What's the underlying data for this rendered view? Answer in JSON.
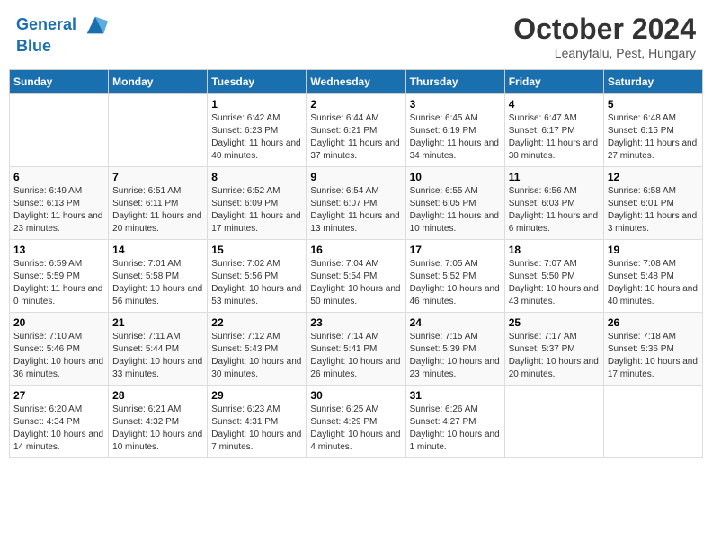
{
  "header": {
    "logo_line1": "General",
    "logo_line2": "Blue",
    "month_title": "October 2024",
    "location": "Leanyfalu, Pest, Hungary"
  },
  "weekdays": [
    "Sunday",
    "Monday",
    "Tuesday",
    "Wednesday",
    "Thursday",
    "Friday",
    "Saturday"
  ],
  "weeks": [
    [
      {
        "day": "",
        "sunrise": "",
        "sunset": "",
        "daylight": ""
      },
      {
        "day": "",
        "sunrise": "",
        "sunset": "",
        "daylight": ""
      },
      {
        "day": "1",
        "sunrise": "Sunrise: 6:42 AM",
        "sunset": "Sunset: 6:23 PM",
        "daylight": "Daylight: 11 hours and 40 minutes."
      },
      {
        "day": "2",
        "sunrise": "Sunrise: 6:44 AM",
        "sunset": "Sunset: 6:21 PM",
        "daylight": "Daylight: 11 hours and 37 minutes."
      },
      {
        "day": "3",
        "sunrise": "Sunrise: 6:45 AM",
        "sunset": "Sunset: 6:19 PM",
        "daylight": "Daylight: 11 hours and 34 minutes."
      },
      {
        "day": "4",
        "sunrise": "Sunrise: 6:47 AM",
        "sunset": "Sunset: 6:17 PM",
        "daylight": "Daylight: 11 hours and 30 minutes."
      },
      {
        "day": "5",
        "sunrise": "Sunrise: 6:48 AM",
        "sunset": "Sunset: 6:15 PM",
        "daylight": "Daylight: 11 hours and 27 minutes."
      }
    ],
    [
      {
        "day": "6",
        "sunrise": "Sunrise: 6:49 AM",
        "sunset": "Sunset: 6:13 PM",
        "daylight": "Daylight: 11 hours and 23 minutes."
      },
      {
        "day": "7",
        "sunrise": "Sunrise: 6:51 AM",
        "sunset": "Sunset: 6:11 PM",
        "daylight": "Daylight: 11 hours and 20 minutes."
      },
      {
        "day": "8",
        "sunrise": "Sunrise: 6:52 AM",
        "sunset": "Sunset: 6:09 PM",
        "daylight": "Daylight: 11 hours and 17 minutes."
      },
      {
        "day": "9",
        "sunrise": "Sunrise: 6:54 AM",
        "sunset": "Sunset: 6:07 PM",
        "daylight": "Daylight: 11 hours and 13 minutes."
      },
      {
        "day": "10",
        "sunrise": "Sunrise: 6:55 AM",
        "sunset": "Sunset: 6:05 PM",
        "daylight": "Daylight: 11 hours and 10 minutes."
      },
      {
        "day": "11",
        "sunrise": "Sunrise: 6:56 AM",
        "sunset": "Sunset: 6:03 PM",
        "daylight": "Daylight: 11 hours and 6 minutes."
      },
      {
        "day": "12",
        "sunrise": "Sunrise: 6:58 AM",
        "sunset": "Sunset: 6:01 PM",
        "daylight": "Daylight: 11 hours and 3 minutes."
      }
    ],
    [
      {
        "day": "13",
        "sunrise": "Sunrise: 6:59 AM",
        "sunset": "Sunset: 5:59 PM",
        "daylight": "Daylight: 11 hours and 0 minutes."
      },
      {
        "day": "14",
        "sunrise": "Sunrise: 7:01 AM",
        "sunset": "Sunset: 5:58 PM",
        "daylight": "Daylight: 10 hours and 56 minutes."
      },
      {
        "day": "15",
        "sunrise": "Sunrise: 7:02 AM",
        "sunset": "Sunset: 5:56 PM",
        "daylight": "Daylight: 10 hours and 53 minutes."
      },
      {
        "day": "16",
        "sunrise": "Sunrise: 7:04 AM",
        "sunset": "Sunset: 5:54 PM",
        "daylight": "Daylight: 10 hours and 50 minutes."
      },
      {
        "day": "17",
        "sunrise": "Sunrise: 7:05 AM",
        "sunset": "Sunset: 5:52 PM",
        "daylight": "Daylight: 10 hours and 46 minutes."
      },
      {
        "day": "18",
        "sunrise": "Sunrise: 7:07 AM",
        "sunset": "Sunset: 5:50 PM",
        "daylight": "Daylight: 10 hours and 43 minutes."
      },
      {
        "day": "19",
        "sunrise": "Sunrise: 7:08 AM",
        "sunset": "Sunset: 5:48 PM",
        "daylight": "Daylight: 10 hours and 40 minutes."
      }
    ],
    [
      {
        "day": "20",
        "sunrise": "Sunrise: 7:10 AM",
        "sunset": "Sunset: 5:46 PM",
        "daylight": "Daylight: 10 hours and 36 minutes."
      },
      {
        "day": "21",
        "sunrise": "Sunrise: 7:11 AM",
        "sunset": "Sunset: 5:44 PM",
        "daylight": "Daylight: 10 hours and 33 minutes."
      },
      {
        "day": "22",
        "sunrise": "Sunrise: 7:12 AM",
        "sunset": "Sunset: 5:43 PM",
        "daylight": "Daylight: 10 hours and 30 minutes."
      },
      {
        "day": "23",
        "sunrise": "Sunrise: 7:14 AM",
        "sunset": "Sunset: 5:41 PM",
        "daylight": "Daylight: 10 hours and 26 minutes."
      },
      {
        "day": "24",
        "sunrise": "Sunrise: 7:15 AM",
        "sunset": "Sunset: 5:39 PM",
        "daylight": "Daylight: 10 hours and 23 minutes."
      },
      {
        "day": "25",
        "sunrise": "Sunrise: 7:17 AM",
        "sunset": "Sunset: 5:37 PM",
        "daylight": "Daylight: 10 hours and 20 minutes."
      },
      {
        "day": "26",
        "sunrise": "Sunrise: 7:18 AM",
        "sunset": "Sunset: 5:36 PM",
        "daylight": "Daylight: 10 hours and 17 minutes."
      }
    ],
    [
      {
        "day": "27",
        "sunrise": "Sunrise: 6:20 AM",
        "sunset": "Sunset: 4:34 PM",
        "daylight": "Daylight: 10 hours and 14 minutes."
      },
      {
        "day": "28",
        "sunrise": "Sunrise: 6:21 AM",
        "sunset": "Sunset: 4:32 PM",
        "daylight": "Daylight: 10 hours and 10 minutes."
      },
      {
        "day": "29",
        "sunrise": "Sunrise: 6:23 AM",
        "sunset": "Sunset: 4:31 PM",
        "daylight": "Daylight: 10 hours and 7 minutes."
      },
      {
        "day": "30",
        "sunrise": "Sunrise: 6:25 AM",
        "sunset": "Sunset: 4:29 PM",
        "daylight": "Daylight: 10 hours and 4 minutes."
      },
      {
        "day": "31",
        "sunrise": "Sunrise: 6:26 AM",
        "sunset": "Sunset: 4:27 PM",
        "daylight": "Daylight: 10 hours and 1 minute."
      },
      {
        "day": "",
        "sunrise": "",
        "sunset": "",
        "daylight": ""
      },
      {
        "day": "",
        "sunrise": "",
        "sunset": "",
        "daylight": ""
      }
    ]
  ]
}
